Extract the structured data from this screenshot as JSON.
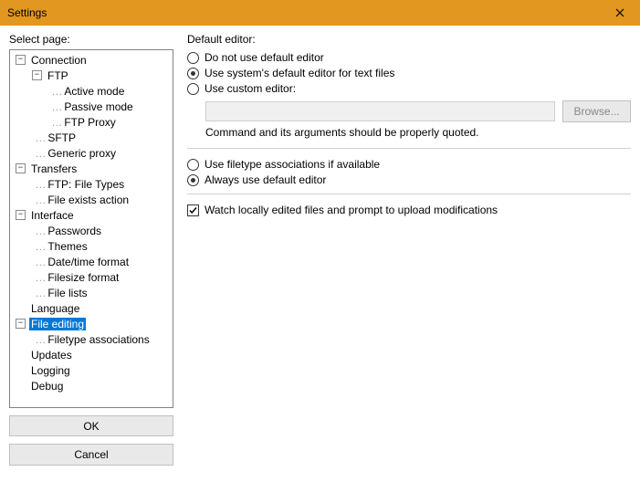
{
  "window": {
    "title": "Settings"
  },
  "left": {
    "label": "Select page:",
    "ok": "OK",
    "cancel": "Cancel"
  },
  "tree": {
    "connection": "Connection",
    "ftp": "FTP",
    "active": "Active mode",
    "passive": "Passive mode",
    "ftpproxy": "FTP Proxy",
    "sftp": "SFTP",
    "genericproxy": "Generic proxy",
    "transfers": "Transfers",
    "ftptypes": "FTP: File Types",
    "fileexists": "File exists action",
    "interface": "Interface",
    "passwords": "Passwords",
    "themes": "Themes",
    "datetime": "Date/time format",
    "filesize": "Filesize format",
    "filelists": "File lists",
    "language": "Language",
    "fileediting": "File editing",
    "filetypeassoc": "Filetype associations",
    "updates": "Updates",
    "logging": "Logging",
    "debug": "Debug"
  },
  "panel": {
    "heading": "Default editor:",
    "opt_none": "Do not use default editor",
    "opt_sys": "Use system's default editor for text files",
    "opt_custom": "Use custom editor:",
    "browse": "Browse...",
    "hint": "Command and its arguments should be properly quoted.",
    "opt_assoc": "Use filetype associations if available",
    "opt_always": "Always use default editor",
    "watch": "Watch locally edited files and prompt to upload modifications"
  }
}
